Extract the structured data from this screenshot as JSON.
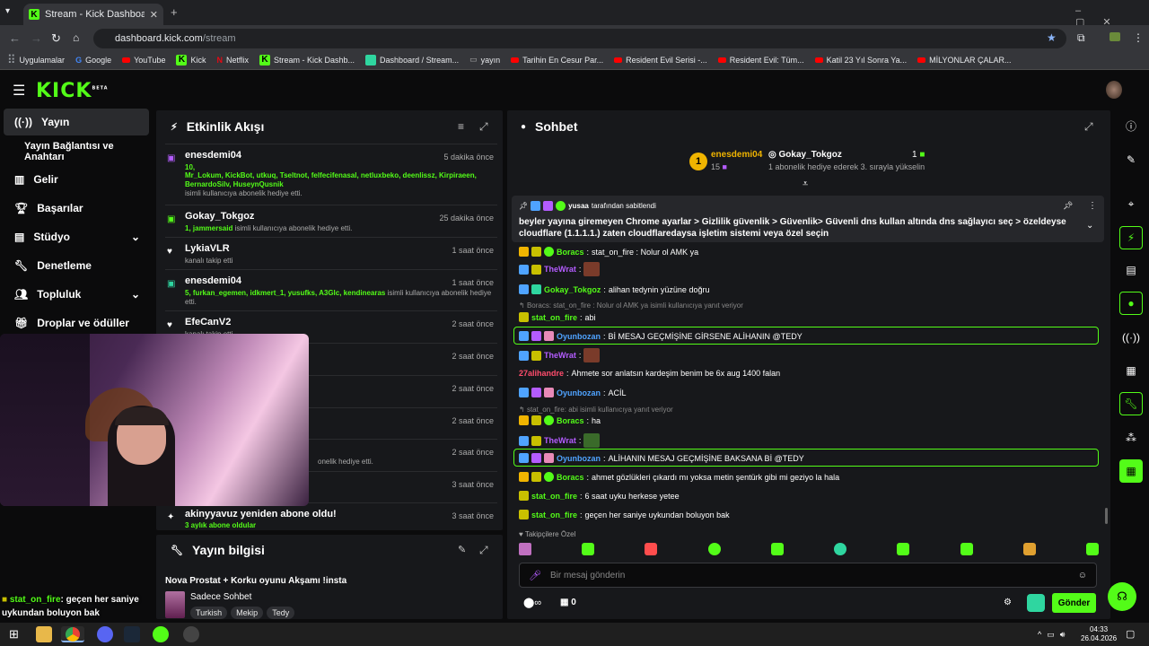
{
  "browser": {
    "tab_title": "Stream - Kick Dashboard",
    "url_host": "dashboard.kick.com",
    "url_path": "/stream",
    "bookmarks": [
      "Uygulamalar",
      "Google",
      "YouTube",
      "Kick",
      "Netflix",
      "Stream - Kick Dashb...",
      "Dashboard / Stream...",
      "yayın",
      "Tarihin En Cesur Par...",
      "Resident Evil Serisi -...",
      "Resident Evil: Tüm...",
      "Katil 23 Yıl Sonra Ya...",
      "MİLYONLAR ÇALAR..."
    ]
  },
  "logo": "KICK",
  "logo_sup": "BETA",
  "sidebar": {
    "items": [
      {
        "label": "Yayın",
        "icon": "broadcast-icon"
      },
      {
        "label": "Yayın Bağlantısı ve Anahtarı",
        "icon": ""
      },
      {
        "label": "Gelir",
        "icon": "chart-icon"
      },
      {
        "label": "Başarılar",
        "icon": "trophy-icon"
      },
      {
        "label": "Stüdyo",
        "icon": "studio-icon"
      },
      {
        "label": "Denetleme",
        "icon": "wrench-icon"
      },
      {
        "label": "Topluluk",
        "icon": "people-icon"
      },
      {
        "label": "Droplar ve ödüller",
        "icon": "gift-icon"
      }
    ]
  },
  "activity": {
    "title": "Etkinlik Akışı",
    "items": [
      {
        "name": "enesdemi04",
        "time": "5 dakika önce",
        "gift": "10,",
        "list": "Mr_Lokum, KickBot, utkuq, Tseltnot, felfecifenasal, netluxbeko, deenlissz, Kirpiraeen, BernardoSilv, HuseynQusnik",
        "sub": "isimli kullanıcıya abonelik hediye etti."
      },
      {
        "name": "Gokay_Tokgoz",
        "time": "25 dakika önce",
        "list": "1, jammersaid",
        "sub": "isimli kullanıcıya abonelik hediye etti."
      },
      {
        "name": "LykiaVLR",
        "time": "1 saat önce",
        "sub": "kanalı takip etti"
      },
      {
        "name": "enesdemi04",
        "time": "1 saat önce",
        "list": "5, furkan_egemen, idkmert_1, yusufks, A3Glc, kendinearas",
        "sub": "isimli kullanıcıya abonelik hediye etti."
      },
      {
        "name": "EfeCanV2",
        "time": "2 saat önce",
        "sub": "kanalı takip etti"
      },
      {
        "time": "2 saat önce"
      },
      {
        "time": "2 saat önce"
      },
      {
        "time": "2 saat önce"
      },
      {
        "time": "2 saat önce",
        "sub": "onelik hediye etti."
      },
      {
        "time": "3 saat önce"
      },
      {
        "name": "akinyyavuz yeniden abone oldu!",
        "time": "3 saat önce",
        "sub": "3 aylık abone oldular"
      }
    ]
  },
  "info": {
    "title": "Yayın bilgisi",
    "stream_title": "Nova Prostat + Korku oyunu Akşamı !insta",
    "category": "Sadece Sohbet",
    "tags": [
      "Turkish",
      "Mekip",
      "Tedy"
    ]
  },
  "chat": {
    "title": "Sohbet",
    "top": {
      "rank": "1",
      "user": "enesdemi04",
      "count": "15",
      "user2": "Gokay_Tokgoz",
      "count2": "1",
      "note": "1 abonelik hediye ederek 3. sırayla yükselin"
    },
    "pinned": {
      "by": "yusaa",
      "by_label": "tarafından sabitlendi",
      "text": "beyler yayına giremeyen Chrome ayarlar > Gizlilik güvenlik > Güvenlik> Güvenli dns kullan altında dns sağlayıcı seç > özeldeyse cloudflare (1.1.1.1.) zaten cloudflaredaysa işletim sistemi veya özel seçin"
    },
    "messages": [
      {
        "user": "Boracs",
        "color": "#53fc18",
        "text": "stat_on_fire : Nolur ol AMK ya"
      },
      {
        "user": "TheWrat",
        "color": "#b45cff",
        "text": ""
      },
      {
        "user": "Gokay_Tokgoz",
        "color": "#53fc18",
        "text": "alihan tedynin yüzüne doğru"
      },
      {
        "reply": "Boracs: stat_on_fire : Nolur ol AMK ya isimli kullanıcıya yanıt veriyor"
      },
      {
        "user": "stat_on_fire",
        "color": "#53fc18",
        "text": "abi"
      },
      {
        "user": "Oyunbozan",
        "color": "#4fa3ff",
        "text": "Bİ MESAJ GEÇMİŞİNE GİRSENE ALİHANIN @TEDY",
        "hl": true
      },
      {
        "user": "TheWrat",
        "color": "#b45cff",
        "text": ""
      },
      {
        "user": "27alihandre",
        "color": "#ff4d6d",
        "text": "Ahmete sor anlatsın kardeşim benim be 6x aug 1400 falan"
      },
      {
        "user": "Oyunbozan",
        "color": "#4fa3ff",
        "text": "ACİL"
      },
      {
        "reply": "stat_on_fire: abi isimli kullanıcıya yanıt veriyor"
      },
      {
        "user": "Boracs",
        "color": "#53fc18",
        "text": "ha"
      },
      {
        "user": "TheWrat",
        "color": "#b45cff",
        "text": ""
      },
      {
        "user": "Oyunbozan",
        "color": "#4fa3ff",
        "text": "ALİHANIN MESAJ GEÇMİŞİNE BAKSANA Bİ @TEDY",
        "hl": true
      },
      {
        "user": "Boracs",
        "color": "#53fc18",
        "text": "ahmet gözlükleri çıkardı mı yoksa metin şentürk gibi mi geziyo la hala"
      },
      {
        "user": "stat_on_fire",
        "color": "#53fc18",
        "text": "6 saat uyku herkese yetee"
      },
      {
        "user": "stat_on_fire",
        "color": "#53fc18",
        "text": "geçen her saniye uykundan boluyon bak"
      }
    ],
    "followers_only": "Takipçilere Özel",
    "placeholder": "Bir mesaj gönderin",
    "points": "0",
    "send": "Gönder"
  },
  "overlay": {
    "user": "stat_on_fire",
    "text": ": geçen her saniye uykundan boluyon bak"
  },
  "clock": {
    "time": "04:33",
    "date": "26.04.2026"
  }
}
